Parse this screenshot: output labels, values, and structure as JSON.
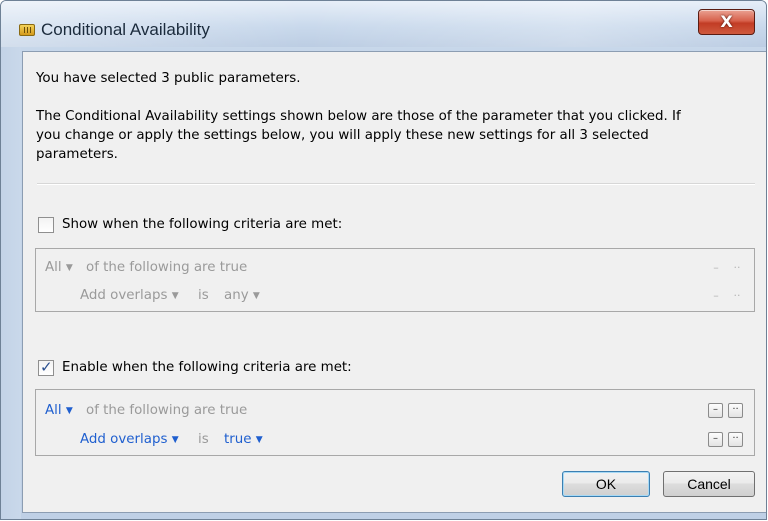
{
  "window": {
    "title": "Conditional Availability",
    "close_label": "X"
  },
  "intro": {
    "line1": "You have selected 3 public parameters.",
    "para_l1": "The Conditional Availability settings shown below are those of the parameter that you clicked. If",
    "para_l2": "you change or apply the settings below, you will apply these new settings for all 3 selected",
    "para_l3": "parameters."
  },
  "show_section": {
    "checkbox_label": "Show when the following criteria are met:",
    "checked": false,
    "quantifier": "All",
    "quantifier_suffix": "of the following are true",
    "criterion_field": "Add overlaps",
    "criterion_op": "is",
    "criterion_value": "any",
    "minus": "–",
    "more": "··"
  },
  "enable_section": {
    "checkbox_label": "Enable when the following criteria are met:",
    "checked": true,
    "check_glyph": "✓",
    "quantifier": "All",
    "quantifier_suffix": "of the following are true",
    "criterion_field": "Add overlaps",
    "criterion_op": "is",
    "criterion_value": "true",
    "minus": "–",
    "more": "··"
  },
  "dropdown_glyph": "▼",
  "buttons": {
    "ok": "OK",
    "cancel": "Cancel"
  },
  "colors": {
    "link_blue": "#1f5fcf",
    "disabled_gray": "#9a9a9a",
    "close_red": "#c23c25"
  },
  "icons": {
    "app": "parameter-icon",
    "close": "close-icon",
    "dropdown": "chevron-down-icon"
  }
}
